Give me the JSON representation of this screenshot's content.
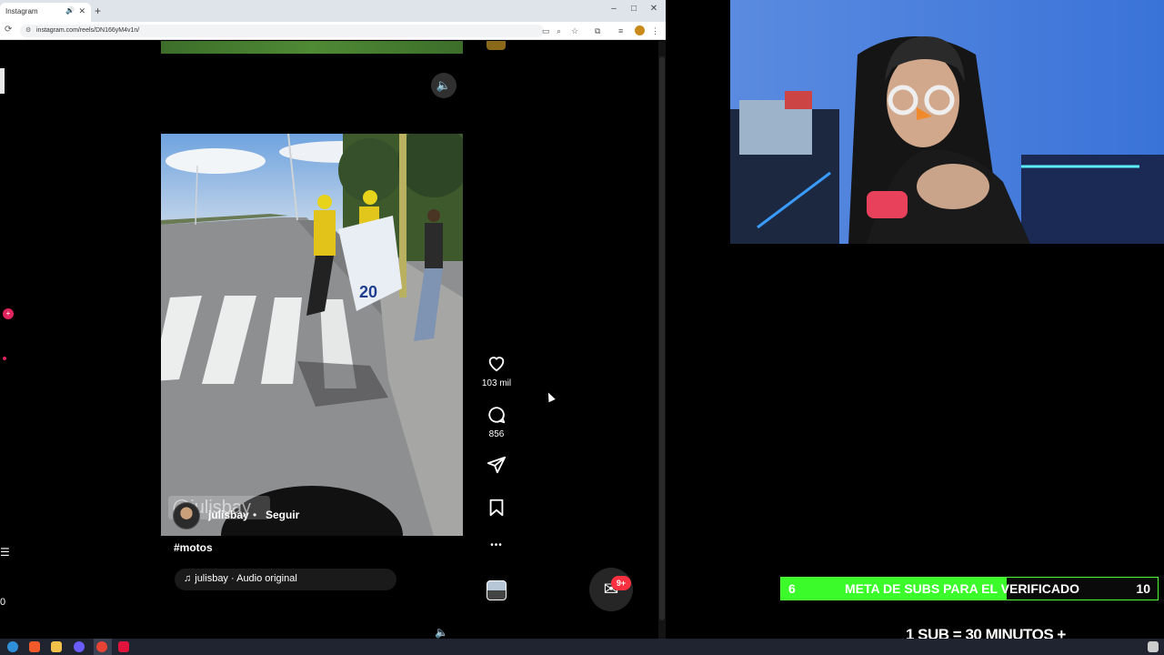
{
  "browser": {
    "tab_title": "Instagram",
    "new_tab": "+",
    "url": "instagram.com/reels/DN166yM4v1n/",
    "window_controls": {
      "minimize": "–",
      "maximize": "□",
      "close": "✕"
    },
    "tab_close": "✕",
    "tab_sound_icon": "speaker-icon"
  },
  "reel": {
    "mute_icon": "🔈",
    "watermark": "@julisbay",
    "author": "julisbay",
    "separator": "•",
    "follow": "Seguir",
    "caption": "#motos",
    "audio": "julisbay · Audio original",
    "actions": {
      "likes": "103 mil",
      "comments": "856",
      "more": "•••"
    }
  },
  "sidebar": {
    "badge": "+",
    "glyph1": "☰",
    "glyph2": "0"
  },
  "messenger": {
    "badge": "9+"
  },
  "overlay": {
    "goal_current": "6",
    "goal_label": "META DE SUBS PARA EL VERIFICADO",
    "goal_target": "10",
    "goal_progress": 0.6,
    "goal_color": "#3cfb2a",
    "sub_rule": "1 SUB = 30 MINUTOS +"
  }
}
